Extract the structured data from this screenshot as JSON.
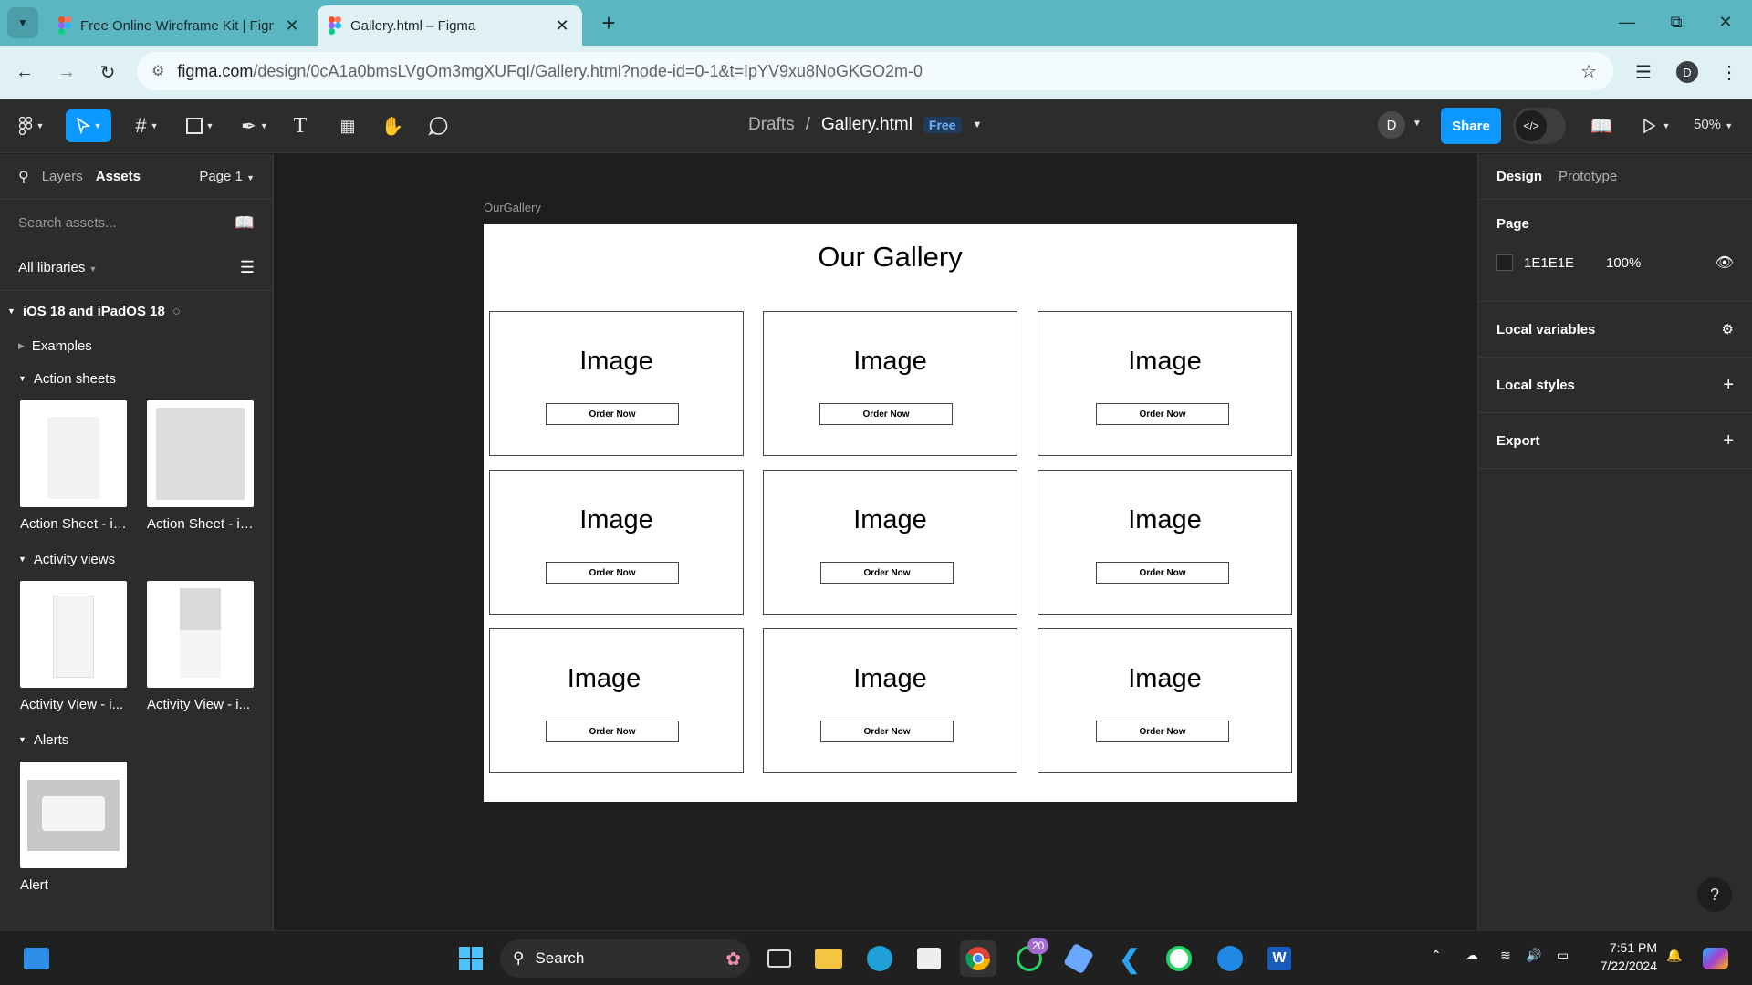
{
  "browser": {
    "tabs": [
      {
        "title": "Free Online Wireframe Kit | Figma"
      },
      {
        "title": "Gallery.html – Figma"
      }
    ],
    "url_host": "figma.com",
    "url_path": "/design/0cA1a0bmsLVgOm3mgXUFqI/Gallery.html?node-id=0-1&t=IpYV9xu8NoGKGO2m-0",
    "profile_initial": "D"
  },
  "figma_toolbar": {
    "breadcrumb_folder": "Drafts",
    "breadcrumb_sep": "/",
    "file_name": "Gallery.html",
    "plan_badge": "Free",
    "avatar_initial": "D",
    "share_label": "Share",
    "zoom": "50%"
  },
  "left_panel": {
    "tab_layers": "Layers",
    "tab_assets": "Assets",
    "page_selector": "Page 1",
    "search_placeholder": "Search assets...",
    "library_filter": "All libraries",
    "library_name": "iOS 18 and iPadOS 18",
    "groups": {
      "examples": "Examples",
      "action_sheets": "Action sheets",
      "activity_views": "Activity views",
      "alerts": "Alerts"
    },
    "action_sheet_items": [
      "Action Sheet - iP...",
      "Action Sheet - iP..."
    ],
    "activity_view_items": [
      "Activity View - i...",
      "Activity View - i..."
    ],
    "alert_items": [
      "Alert"
    ]
  },
  "canvas": {
    "frame_label": "OurGallery",
    "frame_title": "Our Gallery",
    "cards": [
      {
        "image": "Image",
        "button": "Order Now"
      },
      {
        "image": "Image",
        "button": "Order Now"
      },
      {
        "image": "Image",
        "button": "Order Now"
      },
      {
        "image": "Image",
        "button": "Order Now"
      },
      {
        "image": "Image",
        "button": "Order Now"
      },
      {
        "image": "Image",
        "button": "Order Now"
      },
      {
        "image": "Image",
        "button": "Order Now"
      },
      {
        "image": "Image",
        "button": "Order Now"
      },
      {
        "image": "Image",
        "button": "Order Now"
      }
    ]
  },
  "right_panel": {
    "tab_design": "Design",
    "tab_prototype": "Prototype",
    "page_label": "Page",
    "page_color": "1E1E1E",
    "page_opacity": "100%",
    "local_variables": "Local variables",
    "local_styles": "Local styles",
    "export": "Export",
    "help": "?"
  },
  "taskbar": {
    "search_label": "Search",
    "whatsapp_badge": "20",
    "time": "7:51 PM",
    "date": "7/22/2024"
  },
  "colors": {
    "accent": "#0d99ff",
    "tabbar": "#5ab6c0",
    "canvas_bg": "#1e1e1e",
    "panel_bg": "#2c2c2c"
  }
}
